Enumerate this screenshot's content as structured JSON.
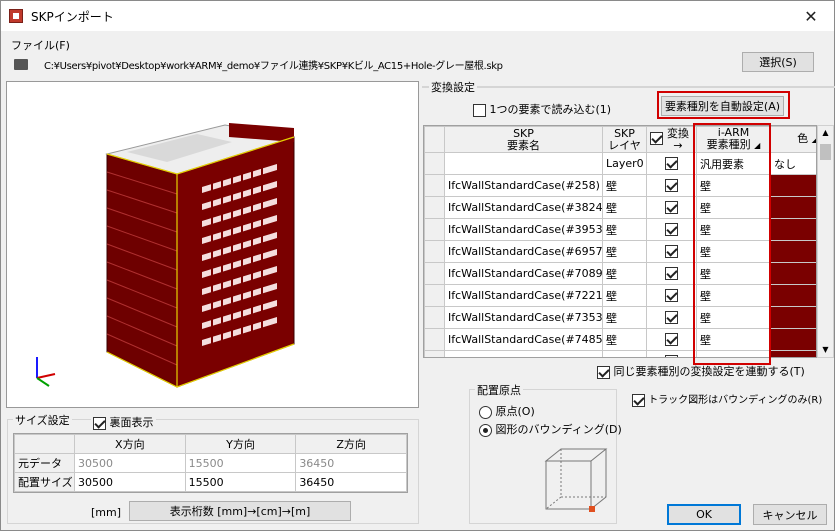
{
  "window": {
    "title": "SKPインポート",
    "close_glyph": "✕"
  },
  "file": {
    "label": "ファイル(F)",
    "path": "C:¥Users¥pivot¥Desktop¥work¥ARM¥_demo¥ファイル連携¥SKP¥Kビル_AC15+Hole-グレー屋根.skp",
    "select_button": "選択(S)"
  },
  "conversion": {
    "section_label": "変換設定",
    "load_as_one": {
      "label": "1つの要素で読み込む(1)",
      "checked": false
    },
    "auto_set_button": "要素種別を自動設定(A)",
    "columns": {
      "skp_element": [
        "SKP",
        "要素名"
      ],
      "skp_layer": [
        "SKP",
        "レイヤ"
      ],
      "convert": [
        "変換",
        "→"
      ],
      "iarm_type": [
        "i-ARM",
        "要素種別"
      ],
      "color": "色"
    },
    "rows": [
      {
        "name": "",
        "layer": "Layer0",
        "convert": true,
        "type": "汎用要素",
        "color": "なし"
      },
      {
        "name": "IfcWallStandardCase(#258)",
        "layer": "壁",
        "convert": true,
        "type": "壁",
        "color": ""
      },
      {
        "name": "IfcWallStandardCase(#3824)",
        "layer": "壁",
        "convert": true,
        "type": "壁",
        "color": ""
      },
      {
        "name": "IfcWallStandardCase(#3953)",
        "layer": "壁",
        "convert": true,
        "type": "壁",
        "color": ""
      },
      {
        "name": "IfcWallStandardCase(#6957)",
        "layer": "壁",
        "convert": true,
        "type": "壁",
        "color": ""
      },
      {
        "name": "IfcWallStandardCase(#7089)",
        "layer": "壁",
        "convert": true,
        "type": "壁",
        "color": ""
      },
      {
        "name": "IfcWallStandardCase(#7221)",
        "layer": "壁",
        "convert": true,
        "type": "壁",
        "color": ""
      },
      {
        "name": "IfcWallStandardCase(#7353)",
        "layer": "壁",
        "convert": true,
        "type": "壁",
        "color": ""
      },
      {
        "name": "IfcWallStandardCase(#7485)",
        "layer": "壁",
        "convert": true,
        "type": "壁",
        "color": ""
      },
      {
        "name": "",
        "layer": "",
        "convert": true,
        "type": "",
        "color": ""
      }
    ],
    "link_same_type": {
      "label": "同じ要素種別の変換設定を連動する(T)",
      "checked": true
    },
    "truck_bounding": {
      "label": "トラック図形はバウンディングのみ(R)",
      "checked": true
    }
  },
  "origin": {
    "label": "配置原点",
    "options": [
      {
        "label": "原点(O)",
        "selected": false
      },
      {
        "label": "図形のバウンディング(D)",
        "selected": true
      }
    ]
  },
  "size": {
    "label": "サイズ設定",
    "back_face": {
      "label": "裏面表示",
      "checked": true
    },
    "headers": [
      "",
      "X方向",
      "Y方向",
      "Z方向"
    ],
    "rows": [
      {
        "label": "元データ",
        "x": "30500",
        "y": "15500",
        "z": "36450"
      },
      {
        "label": "配置サイズ",
        "x": "30500",
        "y": "15500",
        "z": "36450"
      }
    ],
    "unit": "[mm]",
    "digits_button": "表示桁数 [mm]→[cm]→[m]"
  },
  "ok_button": "OK",
  "cancel_button": "キャンセル",
  "colors": {
    "wall": "#7a0000",
    "highlight": "#d10000",
    "accent": "#0078d7"
  }
}
